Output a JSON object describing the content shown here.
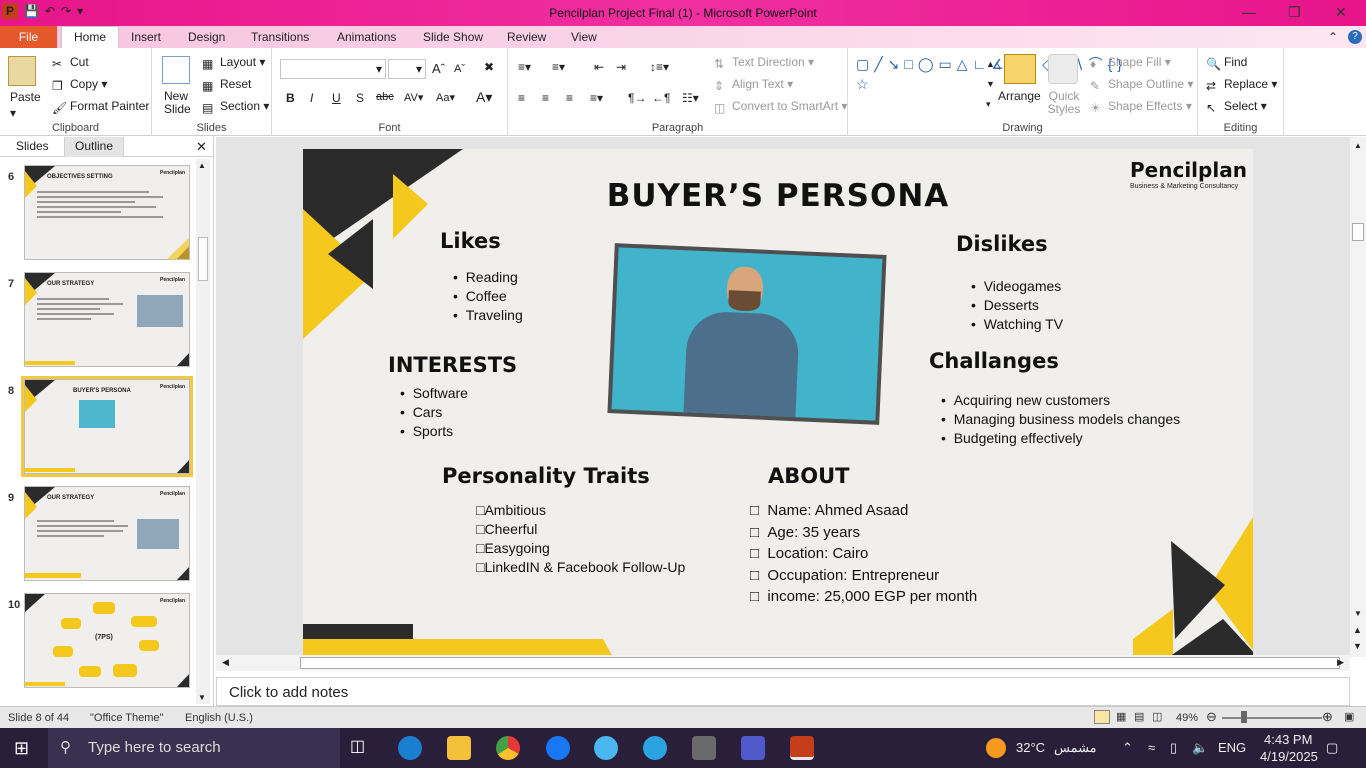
{
  "window": {
    "title": "Pencilplan Project Final (1)  -  Microsoft PowerPoint"
  },
  "tabs": [
    "File",
    "Home",
    "Insert",
    "Design",
    "Transitions",
    "Animations",
    "Slide Show",
    "Review",
    "View"
  ],
  "ribbon": {
    "clipboard": {
      "paste": "Paste",
      "cut": "Cut",
      "copy": "Copy",
      "format_painter": "Format Painter",
      "label": "Clipboard"
    },
    "slides": {
      "new_slide": "New Slide",
      "layout": "Layout",
      "reset": "Reset",
      "section": "Section",
      "label": "Slides"
    },
    "font": {
      "label": "Font"
    },
    "paragraph": {
      "text_direction": "Text Direction",
      "align_text": "Align Text",
      "convert": "Convert to SmartArt",
      "label": "Paragraph"
    },
    "drawing": {
      "arrange": "Arrange",
      "quick_styles": "Quick Styles",
      "shape_fill": "Shape Fill",
      "shape_outline": "Shape Outline",
      "shape_effects": "Shape Effects",
      "label": "Drawing"
    },
    "editing": {
      "find": "Find",
      "replace": "Replace",
      "select": "Select",
      "label": "Editing"
    }
  },
  "side_panel": {
    "tabs": [
      "Slides",
      "Outline"
    ],
    "slides": [
      {
        "num": "6",
        "title": "OBJECTIVES  SETTING"
      },
      {
        "num": "7",
        "title": "OUR STRATEGY"
      },
      {
        "num": "8",
        "title": "BUYER'S PERSONA"
      },
      {
        "num": "9",
        "title": "OUR STRATEGY"
      },
      {
        "num": "10",
        "title": "(7PS)"
      }
    ]
  },
  "slide": {
    "title": "BUYER’S PERSONA",
    "brand": "Pencilplan",
    "brand_sub": "Business & Marketing Consultancy",
    "likes_title": "Likes",
    "likes": [
      "Reading",
      "Coffee",
      "Traveling"
    ],
    "dislikes_title": "Dislikes",
    "dislikes": [
      "Videogames",
      "Desserts",
      "Watching TV"
    ],
    "interests_title": "INTERESTS",
    "interests": [
      "Software",
      "Cars",
      "Sports"
    ],
    "challenges_title": "Challanges",
    "challenges": [
      "Acquiring new customers",
      "Managing business models changes",
      "Budgeting effectively"
    ],
    "traits_title": "Personality Traits",
    "traits": [
      "Ambitious",
      "Cheerful",
      "Easygoing",
      "LinkedIN & Facebook Follow-Up"
    ],
    "about_title": "ABOUT",
    "about": [
      "Name: Ahmed Asaad",
      "Age: 35 years",
      "Location: Cairo",
      "Occupation:  Entrepreneur",
      "income: 25,000 EGP per month"
    ]
  },
  "notes_placeholder": "Click to add notes",
  "status": {
    "slide": "Slide 8 of 44",
    "theme": "\"Office Theme\"",
    "lang": "English (U.S.)",
    "zoom": "49%"
  },
  "taskbar": {
    "search": "Type here to search",
    "temp": "32°C",
    "weather": "مشمس",
    "lang": "ENG",
    "time": "4:43 PM",
    "date": "4/19/2025"
  },
  "colors": {
    "accent_yellow": "#f5c81e",
    "dark": "#2b2b2b",
    "titlebar": "#e8148a",
    "file_tab": "#e5582c"
  }
}
